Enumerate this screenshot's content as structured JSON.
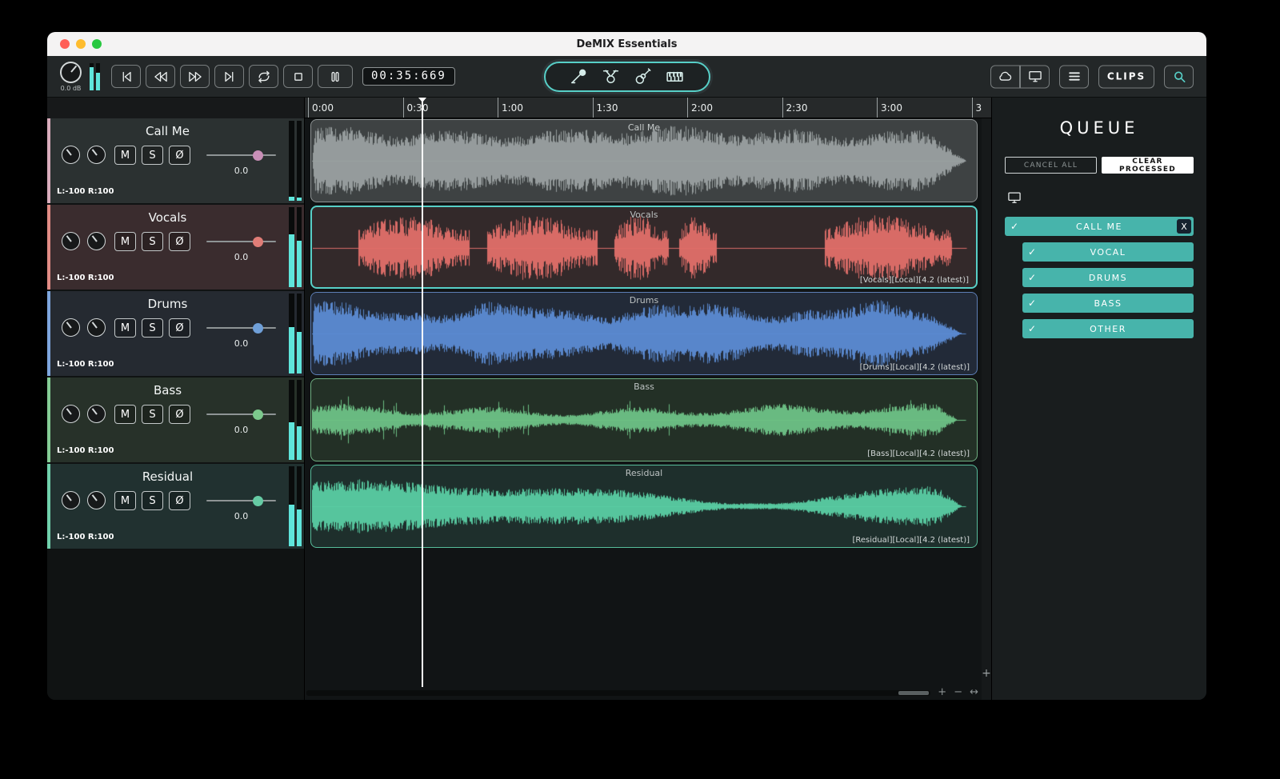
{
  "window": {
    "title": "DeMIX Essentials"
  },
  "toolbar": {
    "gain_readout": "0.0 dB",
    "time": "00:35:669",
    "clips_label": "CLIPS",
    "meter": [
      0.85,
      0.62
    ]
  },
  "icons": {
    "transport": [
      "skip-start",
      "rewind",
      "fast-forward",
      "skip-end",
      "loop",
      "stop",
      "pause"
    ],
    "instruments": [
      "microphone",
      "drums",
      "guitar",
      "piano"
    ],
    "right_buttons": [
      "cloud",
      "display",
      "menu",
      "search"
    ]
  },
  "timeline": {
    "ticks": [
      "0:00",
      "0:30",
      "1:00",
      "1:30",
      "2:00",
      "2:30",
      "3:00",
      "3"
    ]
  },
  "track_controls": {
    "mute": "M",
    "solo": "S",
    "phase": "Ø"
  },
  "tracks": [
    {
      "name": "Call Me",
      "gain": "0.0",
      "pan": "L:-100 R:100",
      "selected": false,
      "meter": [
        0.05,
        0.04
      ],
      "colors": {
        "row_bg": "#2b3131",
        "stripe": "#d9adbc",
        "handle": "#c88fb7",
        "clip_bg": "#3e4243",
        "clip_border": "#8d9293",
        "wave": "#9aa0a1",
        "title": "#c6cbcb"
      },
      "clip": {
        "title": "Call Me",
        "label": ""
      },
      "waveform": {
        "style": "mix",
        "seed": 7
      }
    },
    {
      "name": "Vocals",
      "gain": "0.0",
      "pan": "L:-100 R:100",
      "selected": true,
      "meter": [
        0.66,
        0.58
      ],
      "colors": {
        "row_bg": "#3a2c2e",
        "stripe": "#e18b85",
        "handle": "#e07d77",
        "clip_bg": "#33292a",
        "clip_border": "#57cfc7",
        "wave": "#e26f69",
        "title": "#bcc2c2"
      },
      "clip": {
        "title": "Vocals",
        "label": "[Vocals][Local][4.2 (latest)]"
      },
      "waveform": {
        "style": "bursts",
        "seed": 11,
        "bursts": [
          [
            0.068,
            0.236
          ],
          [
            0.262,
            0.428
          ],
          [
            0.454,
            0.536
          ],
          [
            0.551,
            0.608
          ],
          [
            0.77,
            0.962
          ]
        ]
      }
    },
    {
      "name": "Drums",
      "gain": "0.0",
      "pan": "L:-100 R:100",
      "selected": false,
      "meter": [
        0.58,
        0.52
      ],
      "colors": {
        "row_bg": "#252a31",
        "stripe": "#7ea6de",
        "handle": "#6f9fd8",
        "clip_bg": "#222a38",
        "clip_border": "#5d7eb6",
        "wave": "#5c8bd3",
        "title": "#bcc2c2"
      },
      "clip": {
        "title": "Drums",
        "label": "[Drums][Local][4.2 (latest)]"
      },
      "waveform": {
        "style": "dense",
        "seed": 23
      }
    },
    {
      "name": "Bass",
      "gain": "0.0",
      "pan": "L:-100 R:100",
      "selected": false,
      "meter": [
        0.47,
        0.42
      ],
      "colors": {
        "row_bg": "#273129",
        "stripe": "#85cd95",
        "handle": "#7cc98d",
        "clip_bg": "#233026",
        "clip_border": "#6fae80",
        "wave": "#6ec286",
        "title": "#bcc2c2"
      },
      "clip": {
        "title": "Bass",
        "label": "[Bass][Local][4.2 (latest)]"
      },
      "waveform": {
        "style": "bass",
        "seed": 31
      }
    },
    {
      "name": "Residual",
      "gain": "0.0",
      "pan": "L:-100 R:100",
      "selected": false,
      "meter": [
        0.52,
        0.46
      ],
      "colors": {
        "row_bg": "#213130",
        "stripe": "#70d1ac",
        "handle": "#66cba4",
        "clip_bg": "#1e2f2c",
        "clip_border": "#57bd9b",
        "wave": "#5acda3",
        "title": "#bcc2c2"
      },
      "clip": {
        "title": "Residual",
        "label": "[Residual][Local][4.2 (latest)]"
      },
      "waveform": {
        "style": "varied",
        "seed": 41
      }
    }
  ],
  "scrollbar": {
    "zoom_in": "+",
    "zoom_out": "−",
    "fit": "↔",
    "v_zoom": "+"
  },
  "queue": {
    "title": "QUEUE",
    "cancel_all": "CANCEL ALL",
    "clear_processed": "CLEAR PROCESSED",
    "check_glyph": "✓",
    "job": {
      "name": "CALL ME",
      "close": "X"
    },
    "stems": [
      "VOCAL",
      "DRUMS",
      "BASS",
      "OTHER"
    ]
  },
  "colors": {
    "accent": "#57cfc7",
    "queue_item": "#47b4ab",
    "meter_fill": "#5fe5db"
  }
}
